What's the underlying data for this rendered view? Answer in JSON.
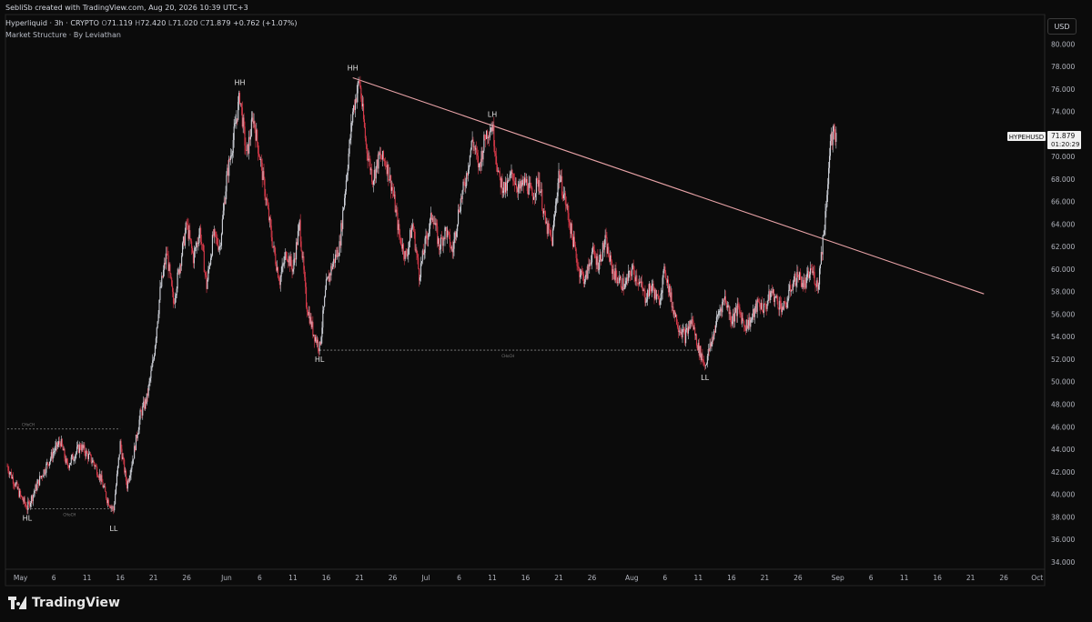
{
  "header": {
    "credit": "SebliSb created with TradingView.com, Aug 20, 2026 10:39 UTC+3",
    "symbol": "Hyperliquid · 3h · CRYPTO",
    "open_label": "O",
    "open": "71.119",
    "high_label": "H",
    "high": "72.420",
    "low_label": "L",
    "low": "71.020",
    "close_label": "C",
    "close": "71.879",
    "change": "+0.762 (+1.07%)",
    "indicator": "Market Structure · By Leviathan"
  },
  "currency": "USD",
  "price_tag": {
    "ticker": "HYPEHUSD",
    "price": "71.879",
    "countdown": "01:20:29"
  },
  "brand": "TradingView",
  "colors": {
    "up": "#d1d4dc",
    "down": "#d93a4a",
    "trendline": "#e8a3a7",
    "background": "#0b0b0b"
  },
  "chart_data": {
    "type": "candlestick",
    "title": "",
    "ylim": [
      33.5,
      81
    ],
    "yticks": [
      34,
      36,
      38,
      40,
      42,
      44,
      46,
      48,
      50,
      52,
      54,
      56,
      58,
      60,
      62,
      64,
      66,
      68,
      70,
      72,
      74,
      76,
      78,
      80
    ],
    "xlim": [
      "2026-04-29",
      "2026-10-02"
    ],
    "x_ticks": [
      {
        "date": "2026-05-01",
        "label": "May"
      },
      {
        "date": "2026-05-06",
        "label": "6"
      },
      {
        "date": "2026-05-11",
        "label": "11"
      },
      {
        "date": "2026-05-16",
        "label": "16"
      },
      {
        "date": "2026-05-21",
        "label": "21"
      },
      {
        "date": "2026-05-26",
        "label": "26"
      },
      {
        "date": "2026-06-01",
        "label": "Jun"
      },
      {
        "date": "2026-06-06",
        "label": "6"
      },
      {
        "date": "2026-06-11",
        "label": "11"
      },
      {
        "date": "2026-06-16",
        "label": "16"
      },
      {
        "date": "2026-06-21",
        "label": "21"
      },
      {
        "date": "2026-06-26",
        "label": "26"
      },
      {
        "date": "2026-07-01",
        "label": "Jul"
      },
      {
        "date": "2026-07-06",
        "label": "6"
      },
      {
        "date": "2026-07-11",
        "label": "11"
      },
      {
        "date": "2026-07-16",
        "label": "16"
      },
      {
        "date": "2026-07-21",
        "label": "21"
      },
      {
        "date": "2026-07-26",
        "label": "26"
      },
      {
        "date": "2026-08-01",
        "label": "Aug"
      },
      {
        "date": "2026-08-06",
        "label": "6"
      },
      {
        "date": "2026-08-11",
        "label": "11"
      },
      {
        "date": "2026-08-16",
        "label": "16"
      },
      {
        "date": "2026-08-21",
        "label": "21"
      },
      {
        "date": "2026-08-26",
        "label": "26"
      },
      {
        "date": "2026-09-01",
        "label": "Sep"
      },
      {
        "date": "2026-09-06",
        "label": "6"
      },
      {
        "date": "2026-09-11",
        "label": "11"
      },
      {
        "date": "2026-09-16",
        "label": "16"
      },
      {
        "date": "2026-09-21",
        "label": "21"
      },
      {
        "date": "2026-09-26",
        "label": "26"
      },
      {
        "date": "2026-10-01",
        "label": "Oct"
      }
    ],
    "price_path": [
      [
        "2026-04-29",
        42.5
      ],
      [
        "2026-05-01",
        39.8
      ],
      [
        "2026-05-02",
        38.8
      ],
      [
        "2026-05-04",
        41.5
      ],
      [
        "2026-05-06",
        43.8
      ],
      [
        "2026-05-07",
        44.7
      ],
      [
        "2026-05-08",
        42.5
      ],
      [
        "2026-05-10",
        44.3
      ],
      [
        "2026-05-12",
        42.8
      ],
      [
        "2026-05-13",
        41.5
      ],
      [
        "2026-05-14",
        39.6
      ],
      [
        "2026-05-15",
        38.6
      ],
      [
        "2026-05-16",
        44.5
      ],
      [
        "2026-05-17",
        40.8
      ],
      [
        "2026-05-18",
        43.5
      ],
      [
        "2026-05-19",
        47.0
      ],
      [
        "2026-05-20",
        48.5
      ],
      [
        "2026-05-21",
        52.0
      ],
      [
        "2026-05-22",
        58.0
      ],
      [
        "2026-05-23",
        61.5
      ],
      [
        "2026-05-24",
        57.0
      ],
      [
        "2026-05-25",
        60.5
      ],
      [
        "2026-05-26",
        64.0
      ],
      [
        "2026-05-27",
        61.0
      ],
      [
        "2026-05-28",
        63.5
      ],
      [
        "2026-05-29",
        58.5
      ],
      [
        "2026-05-30",
        63.0
      ],
      [
        "2026-05-31",
        62.0
      ],
      [
        "2026-06-01",
        68.0
      ],
      [
        "2026-06-02",
        71.5
      ],
      [
        "2026-06-03",
        75.4
      ],
      [
        "2026-06-04",
        70.0
      ],
      [
        "2026-06-05",
        73.5
      ],
      [
        "2026-06-06",
        70.0
      ],
      [
        "2026-06-07",
        66.0
      ],
      [
        "2026-06-08",
        62.0
      ],
      [
        "2026-06-09",
        59.0
      ],
      [
        "2026-06-10",
        61.5
      ],
      [
        "2026-06-11",
        60.0
      ],
      [
        "2026-06-12",
        64.0
      ],
      [
        "2026-06-13",
        57.0
      ],
      [
        "2026-06-14",
        54.5
      ],
      [
        "2026-06-15",
        53.0
      ],
      [
        "2026-06-16",
        58.5
      ],
      [
        "2026-06-17",
        60.5
      ],
      [
        "2026-06-18",
        62.0
      ],
      [
        "2026-06-19",
        68.0
      ],
      [
        "2026-06-20",
        74.0
      ],
      [
        "2026-06-21",
        76.8
      ],
      [
        "2026-06-22",
        71.0
      ],
      [
        "2026-06-23",
        68.0
      ],
      [
        "2026-06-24",
        70.0
      ],
      [
        "2026-06-25",
        69.5
      ],
      [
        "2026-06-26",
        67.0
      ],
      [
        "2026-06-27",
        63.0
      ],
      [
        "2026-06-28",
        61.0
      ],
      [
        "2026-06-29",
        64.0
      ],
      [
        "2026-06-30",
        59.5
      ],
      [
        "2026-07-01",
        62.5
      ],
      [
        "2026-07-02",
        65.0
      ],
      [
        "2026-07-03",
        62.0
      ],
      [
        "2026-07-04",
        63.5
      ],
      [
        "2026-07-05",
        61.5
      ],
      [
        "2026-07-06",
        65.5
      ],
      [
        "2026-07-07",
        68.0
      ],
      [
        "2026-07-08",
        71.5
      ],
      [
        "2026-07-09",
        69.0
      ],
      [
        "2026-07-10",
        72.0
      ],
      [
        "2026-07-11",
        72.8
      ],
      [
        "2026-07-12",
        68.0
      ],
      [
        "2026-07-13",
        67.0
      ],
      [
        "2026-07-14",
        68.5
      ],
      [
        "2026-07-15",
        67.0
      ],
      [
        "2026-07-16",
        67.8
      ],
      [
        "2026-07-17",
        66.5
      ],
      [
        "2026-07-18",
        68.0
      ],
      [
        "2026-07-19",
        64.0
      ],
      [
        "2026-07-20",
        62.5
      ],
      [
        "2026-07-21",
        68.5
      ],
      [
        "2026-07-22",
        66.0
      ],
      [
        "2026-07-23",
        63.0
      ],
      [
        "2026-07-24",
        60.0
      ],
      [
        "2026-07-25",
        59.0
      ],
      [
        "2026-07-26",
        61.5
      ],
      [
        "2026-07-27",
        60.5
      ],
      [
        "2026-07-28",
        62.5
      ],
      [
        "2026-07-29",
        60.0
      ],
      [
        "2026-07-30",
        59.0
      ],
      [
        "2026-07-31",
        58.5
      ],
      [
        "2026-08-01",
        60.0
      ],
      [
        "2026-08-02",
        59.0
      ],
      [
        "2026-08-03",
        57.5
      ],
      [
        "2026-08-04",
        58.5
      ],
      [
        "2026-08-05",
        57.0
      ],
      [
        "2026-08-06",
        60.0
      ],
      [
        "2026-08-07",
        57.0
      ],
      [
        "2026-08-08",
        55.0
      ],
      [
        "2026-08-09",
        54.0
      ],
      [
        "2026-08-10",
        55.5
      ],
      [
        "2026-08-11",
        53.0
      ],
      [
        "2026-08-12",
        51.5
      ],
      [
        "2026-08-13",
        53.5
      ],
      [
        "2026-08-14",
        56.0
      ],
      [
        "2026-08-15",
        57.5
      ],
      [
        "2026-08-16",
        55.5
      ],
      [
        "2026-08-17",
        56.5
      ],
      [
        "2026-08-18",
        55.0
      ],
      [
        "2026-08-19",
        55.5
      ],
      [
        "2026-08-20",
        57.0
      ],
      [
        "2026-08-21",
        56.5
      ],
      [
        "2026-08-22",
        58.0
      ],
      [
        "2026-08-23",
        57.0
      ],
      [
        "2026-08-24",
        56.5
      ],
      [
        "2026-08-25",
        58.5
      ],
      [
        "2026-08-26",
        59.5
      ],
      [
        "2026-08-27",
        58.5
      ],
      [
        "2026-08-28",
        60.0
      ],
      [
        "2026-08-29",
        58.5
      ],
      [
        "2026-08-30",
        64.0
      ],
      [
        "2026-08-31",
        72.0
      ]
    ],
    "trendline": [
      [
        "2026-06-20",
        77.0
      ],
      [
        "2026-09-23",
        57.8
      ]
    ],
    "structure_lines": [
      {
        "label": "CHoCH",
        "start": "2026-04-29",
        "end": "2026-05-16",
        "price": 45.8
      },
      {
        "label": "CHoCH",
        "start": "2026-05-02",
        "end": "2026-05-15",
        "price": 38.7
      },
      {
        "label": "CHoCH",
        "start": "2026-06-15",
        "end": "2026-08-11",
        "price": 52.8
      }
    ],
    "annotations": [
      {
        "text": "HH",
        "date": "2026-06-03",
        "price": 75.7,
        "position": "above"
      },
      {
        "text": "HH",
        "date": "2026-06-20",
        "price": 77.0,
        "position": "above"
      },
      {
        "text": "LH",
        "date": "2026-07-11",
        "price": 72.9,
        "position": "above"
      },
      {
        "text": "HL",
        "date": "2026-05-02",
        "price": 38.7,
        "position": "below"
      },
      {
        "text": "LL",
        "date": "2026-05-15",
        "price": 37.8,
        "position": "below"
      },
      {
        "text": "HL",
        "date": "2026-06-15",
        "price": 52.8,
        "position": "below"
      },
      {
        "text": "LL",
        "date": "2026-08-12",
        "price": 51.2,
        "position": "below"
      }
    ],
    "last_price": 71.879
  }
}
